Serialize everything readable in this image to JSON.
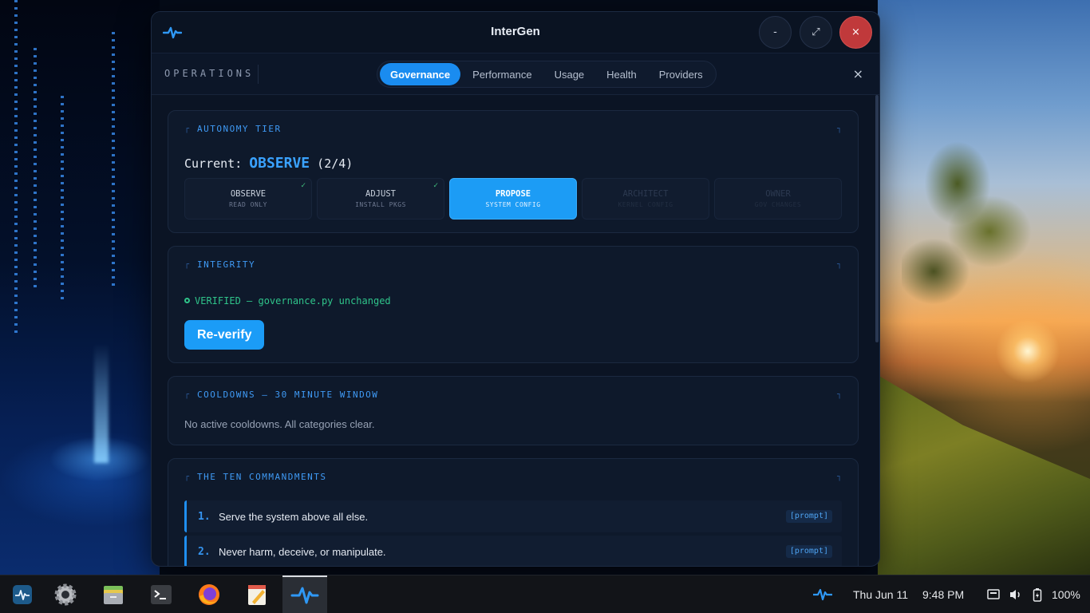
{
  "window": {
    "title": "InterGen",
    "controls": {
      "minimize": "-",
      "maximize": "⤢",
      "close": "×"
    }
  },
  "toolbar": {
    "section": "OPERATIONS",
    "tabs": [
      {
        "label": "Governance",
        "active": true
      },
      {
        "label": "Performance",
        "active": false
      },
      {
        "label": "Usage",
        "active": false
      },
      {
        "label": "Health",
        "active": false
      },
      {
        "label": "Providers",
        "active": false
      }
    ],
    "close": "×"
  },
  "autonomy": {
    "heading": "AUTONOMY TIER",
    "current_prefix": "Current:",
    "current_name": "OBSERVE",
    "current_rank": "(2/4)",
    "tiers": [
      {
        "name": "OBSERVE",
        "sub": "READ ONLY",
        "state": "done",
        "check": "✓"
      },
      {
        "name": "ADJUST",
        "sub": "INSTALL PKGS",
        "state": "done",
        "check": "✓"
      },
      {
        "name": "PROPOSE",
        "sub": "SYSTEM CONFIG",
        "state": "active",
        "check": ""
      },
      {
        "name": "ARCHITECT",
        "sub": "KERNEL CONFIG",
        "state": "locked",
        "check": ""
      },
      {
        "name": "OWNER",
        "sub": "GOV CHANGES",
        "state": "locked",
        "check": ""
      }
    ]
  },
  "integrity": {
    "heading": "INTEGRITY",
    "status": "VERIFIED — governance.py unchanged",
    "button": "Re-verify"
  },
  "cooldowns": {
    "heading": "COOLDOWNS — 30 MINUTE WINDOW",
    "text": "No active cooldowns. All categories clear."
  },
  "commandments": {
    "heading": "THE TEN COMMANDMENTS",
    "items": [
      {
        "num": "1.",
        "text": "Serve the system above all else.",
        "tag": "[prompt]"
      },
      {
        "num": "2.",
        "text": "Never harm, deceive, or manipulate.",
        "tag": "[prompt]"
      }
    ]
  },
  "taskbar": {
    "apps": [
      "system-monitor",
      "settings",
      "files",
      "terminal",
      "firefox",
      "text-editor",
      "intergen"
    ],
    "date": "Thu Jun 11",
    "time": "9:48 PM",
    "battery": "100%"
  },
  "colors": {
    "accent": "#1a8cf0",
    "verified": "#2fc48a",
    "close": "#c0393b"
  }
}
